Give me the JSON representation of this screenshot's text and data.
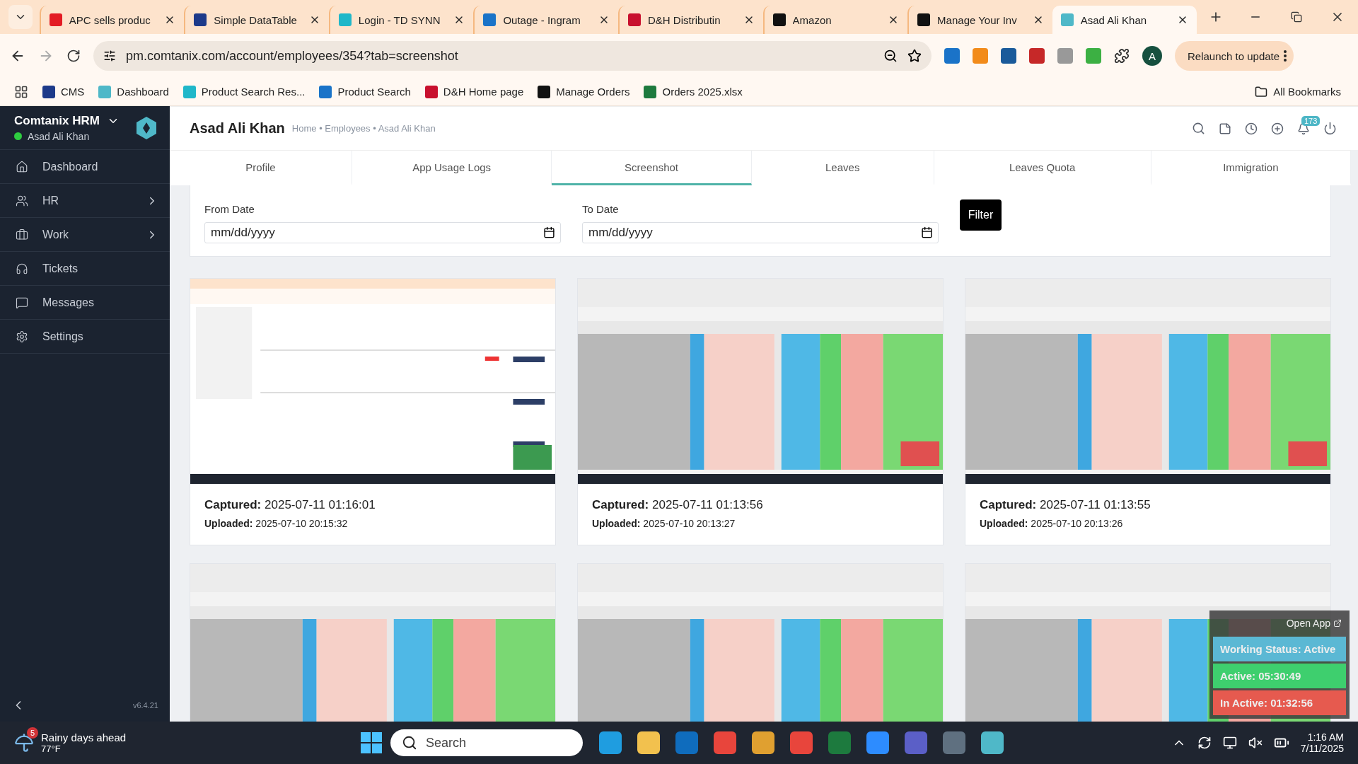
{
  "browser": {
    "tabs": [
      {
        "title": "APC sells produc",
        "selected": false
      },
      {
        "title": "Simple DataTable",
        "selected": false
      },
      {
        "title": "Login - TD SYNN",
        "selected": false
      },
      {
        "title": "Outage - Ingram",
        "selected": false
      },
      {
        "title": "D&H Distributin",
        "selected": false
      },
      {
        "title": "Amazon",
        "selected": false
      },
      {
        "title": "Manage Your Inv",
        "selected": false
      },
      {
        "title": "Asad Ali Khan",
        "selected": true
      }
    ],
    "address": "pm.comtanix.com/account/employees/354?tab=screenshot",
    "profile_initial": "A",
    "relaunch": "Relaunch to update",
    "bookmarks": [
      "CMS",
      "Dashboard",
      "Product Search Res...",
      "Product Search",
      "D&H Home page",
      "Manage Orders",
      "Orders 2025.xlsx"
    ],
    "all_bookmarks": "All Bookmarks"
  },
  "sidebar": {
    "app_name": "Comtanix HRM",
    "user": "Asad Ali Khan",
    "items": [
      {
        "label": "Dashboard",
        "has_children": false
      },
      {
        "label": "HR",
        "has_children": true
      },
      {
        "label": "Work",
        "has_children": true
      },
      {
        "label": "Tickets",
        "has_children": false
      },
      {
        "label": "Messages",
        "has_children": false
      },
      {
        "label": "Settings",
        "has_children": false
      }
    ],
    "version": "v6.4.21"
  },
  "header": {
    "title": "Asad Ali Khan",
    "breadcrumb": "Home • Employees • Asad Ali Khan",
    "notification_count": "173"
  },
  "tabs": [
    {
      "label": "Profile",
      "selected": false
    },
    {
      "label": "App Usage Logs",
      "selected": false
    },
    {
      "label": "Screenshot",
      "selected": true
    },
    {
      "label": "Leaves",
      "selected": false
    },
    {
      "label": "Leaves Quota",
      "selected": false
    },
    {
      "label": "Immigration",
      "selected": false
    }
  ],
  "filter": {
    "from_label": "From Date",
    "from_placeholder": "mm/dd/yyyy",
    "to_label": "To Date",
    "to_placeholder": "mm/dd/yyyy",
    "button": "Filter"
  },
  "screenshots": [
    {
      "kind": "picture",
      "captured_label": "Captured:",
      "captured": "2025-07-11 01:16:01",
      "uploaded_label": "Uploaded:",
      "uploaded": "2025-07-10 20:15:32"
    },
    {
      "kind": "picture",
      "captured_label": "Captured:",
      "captured": "2025-07-11 01:13:56",
      "uploaded_label": "Uploaded:",
      "uploaded": "2025-07-10 20:13:27"
    },
    {
      "kind": "picture",
      "captured_label": "Captured:",
      "captured": "2025-07-11 01:13:55",
      "uploaded_label": "Uploaded:",
      "uploaded": "2025-07-10 20:13:26"
    },
    {
      "kind": "picture"
    },
    {
      "kind": "picture"
    },
    {
      "kind": "picture"
    }
  ],
  "status_widget": {
    "open_app": "Open App",
    "rows": [
      {
        "text": "Working Status: Active",
        "color": "#5bb8d4"
      },
      {
        "text": "Active: 05:30:49",
        "color": "#3ecf6e"
      },
      {
        "text": "In Active: 01:32:56",
        "color": "#e65a4f"
      }
    ]
  },
  "taskbar": {
    "weather_badge": "5",
    "weather_title": "Rainy days ahead",
    "weather_temp": "77°F",
    "search_placeholder": "Search",
    "time": "1:16 AM",
    "date": "7/11/2025"
  }
}
